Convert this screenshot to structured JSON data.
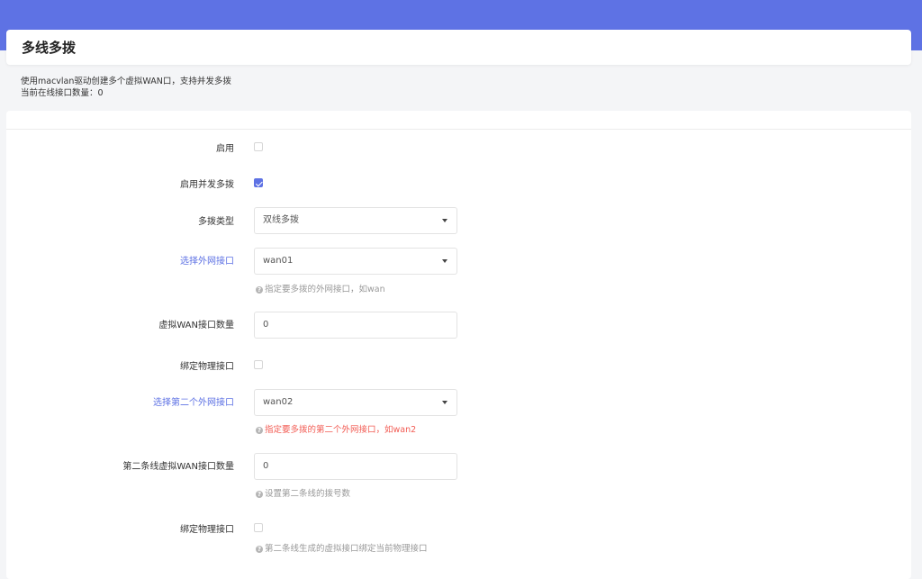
{
  "header": {
    "title": "多线多拨"
  },
  "description": {
    "line1": "使用macvlan驱动创建多个虚拟WAN口，支持并发多拨",
    "line2": "当前在线接口数量：0"
  },
  "form": {
    "enable": {
      "label": "启用",
      "checked": false
    },
    "concurrent": {
      "label": "启用并发多拨",
      "checked": true
    },
    "dial_type": {
      "label": "多拨类型",
      "value": "双线多拨"
    },
    "wan_iface": {
      "label": "选择外网接口",
      "value": "wan01",
      "hint": "指定要多拨的外网接口，如wan"
    },
    "vwan_count": {
      "label": "虚拟WAN接口数量",
      "value": "0"
    },
    "bind_phys1": {
      "label": "绑定物理接口",
      "checked": false
    },
    "wan2_iface": {
      "label": "选择第二个外网接口",
      "value": "wan02",
      "hint": "指定要多拨的第二个外网接口，如wan2"
    },
    "vwan2_count": {
      "label": "第二条线虚拟WAN接口数量",
      "value": "0",
      "hint": "设置第二条线的拨号数"
    },
    "bind_phys2": {
      "label": "绑定物理接口",
      "checked": false,
      "hint": "第二条线生成的虚拟接口绑定当前物理接口"
    }
  },
  "colors": {
    "accent": "#5e72e4",
    "error": "#f25c54"
  },
  "icons": {
    "hint": "question-circle-icon",
    "select": "caret-down-icon"
  }
}
